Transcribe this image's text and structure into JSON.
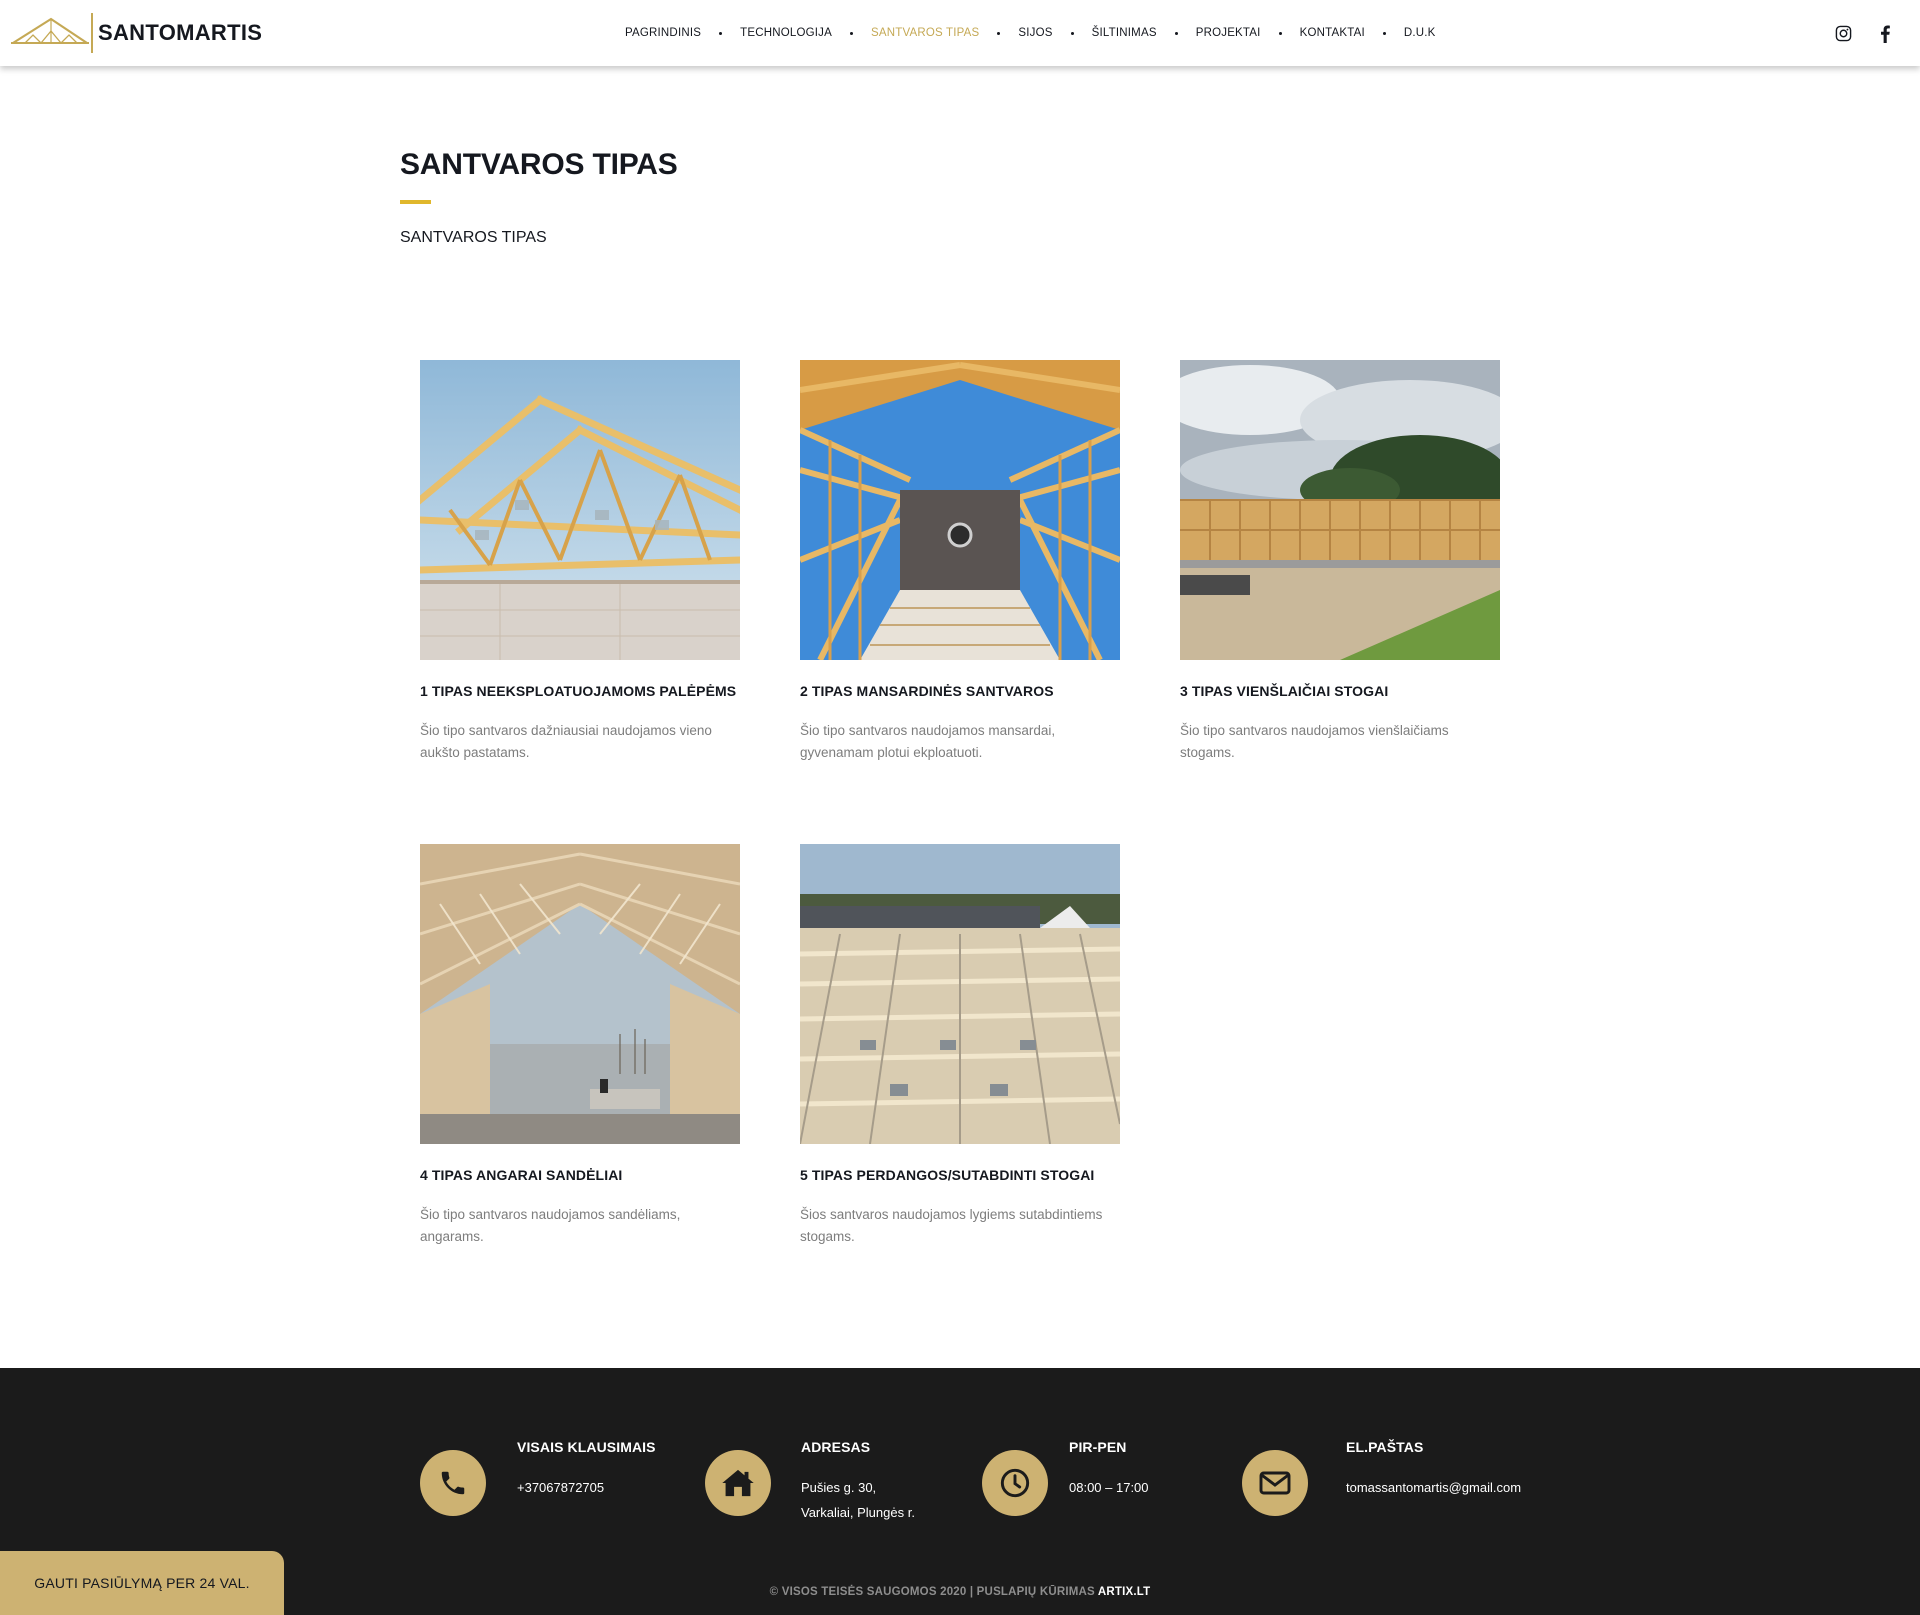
{
  "brand": {
    "name": "SANTOMARTIS",
    "accent": "#c5a955"
  },
  "nav": {
    "items": [
      {
        "label": "PAGRINDINIS",
        "active": false
      },
      {
        "label": "TECHNOLOGIJA",
        "active": false
      },
      {
        "label": "SANTVAROS TIPAS",
        "active": true
      },
      {
        "label": "SIJOS",
        "active": false
      },
      {
        "label": "ŠILTINIMAS",
        "active": false
      },
      {
        "label": "PROJEKTAI",
        "active": false
      },
      {
        "label": "KONTAKTAI",
        "active": false
      },
      {
        "label": "D.U.K",
        "active": false
      }
    ],
    "social": [
      "instagram-icon",
      "facebook-icon"
    ]
  },
  "page": {
    "title": "SANTVAROS TIPAS",
    "breadcrumb": "SANTVAROS TIPAS"
  },
  "cards": [
    {
      "title": "1 TIPAS NEEKSPLOATUOJAMOMS PALĖPĖMS",
      "description": "Šio tipo santvaros dažniausiai naudojamos vieno aukšto pastatams."
    },
    {
      "title": "2 TIPAS MANSARDINĖS SANTVAROS",
      "description": "Šio tipo santvaros naudojamos mansardai, gyvenamam plotui ekploatuoti."
    },
    {
      "title": "3 TIPAS VIENŠLAIČIAI STOGAI",
      "description": "Šio tipo santvaros naudojamos vienšlaičiams stogams."
    },
    {
      "title": "4 TIPAS ANGARAI SANDĖLIAI",
      "description": "Šio tipo santvaros naudojamos sandėliams, angarams."
    },
    {
      "title": "5 TIPAS PERDANGOS/SUTABDINTI STOGAI",
      "description": "Šios santvaros naudojamos lygiems sutabdintiems stogams."
    }
  ],
  "footer": {
    "phone": {
      "label": "VISAIS KLAUSIMAIS",
      "value": "+37067872705",
      "icon": "phone-icon"
    },
    "address": {
      "label": "ADRESAS",
      "line1": "Pušies g. 30,",
      "line2": "Varkaliai, Plungės r.",
      "icon": "home-icon"
    },
    "hours": {
      "label": "PIR-PEN",
      "value": "08:00 – 17:00",
      "icon": "clock-icon"
    },
    "email": {
      "label": "EL.PAŠTAS",
      "value": "tomassantomartis@gmail.com",
      "icon": "envelope-icon"
    },
    "copyright": "© VISOS TEISĖS SAUGOMOS 2020 | PUSLAPIŲ KŪRIMAS",
    "copyright_brand": "ARTIX.LT"
  },
  "quote_button": {
    "label": "GAUTI PASIŪLYMĄ PER 24 VAL."
  },
  "colors": {
    "gold": "#cdb272",
    "title_underline": "#e0b72c",
    "footer_bg": "#1b1b1b"
  }
}
